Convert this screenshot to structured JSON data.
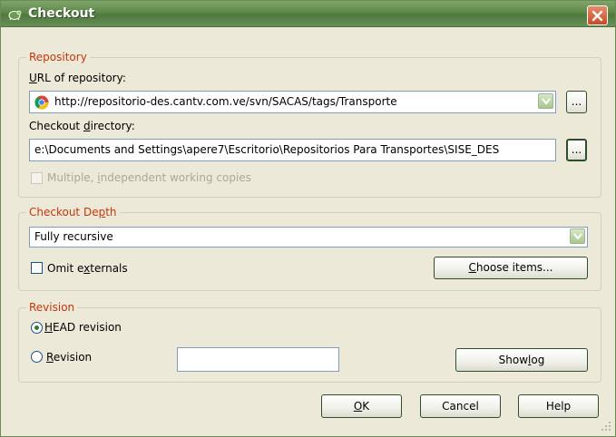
{
  "window": {
    "title": "Checkout",
    "close_label": "✕"
  },
  "repository": {
    "legend": "Repository",
    "url_label_u": "U",
    "url_label_rest": "RL of repository:",
    "url_value": "http://repositorio-des.cantv.com.ve/svn/SACAS/tags/Transporte",
    "url_browse_label": "...",
    "dir_label_pre": "Checkout ",
    "dir_label_u": "d",
    "dir_label_post": "irectory:",
    "dir_value": "e:\\Documents and Settings\\apere7\\Escritorio\\Repositorios Para Transportes\\SISE_DES",
    "dir_browse_label": "...",
    "multiple_pre": "Multiple, ",
    "multiple_u": "i",
    "multiple_post": "ndependent working copies"
  },
  "depth": {
    "legend_pre": "Checkout De",
    "legend_u": "p",
    "legend_post": "th",
    "value": "Fully recursive",
    "omit_pre": "Omit e",
    "omit_u": "x",
    "omit_post": "ternals",
    "choose_u": "C",
    "choose_rest": "hoose items..."
  },
  "revision": {
    "legend": "Revision",
    "head_u": "H",
    "head_rest": "EAD revision",
    "rev_u": "R",
    "rev_rest": "evision",
    "rev_value": "",
    "show_log_pre": "Show ",
    "show_log_u": "l",
    "show_log_post": "og"
  },
  "buttons": {
    "ok_u": "O",
    "ok_rest": "K",
    "cancel": "Cancel",
    "help": "Help"
  },
  "colors": {
    "legend": "#c6360c",
    "titlebar": "#5e874a",
    "close": "#c94b24"
  }
}
